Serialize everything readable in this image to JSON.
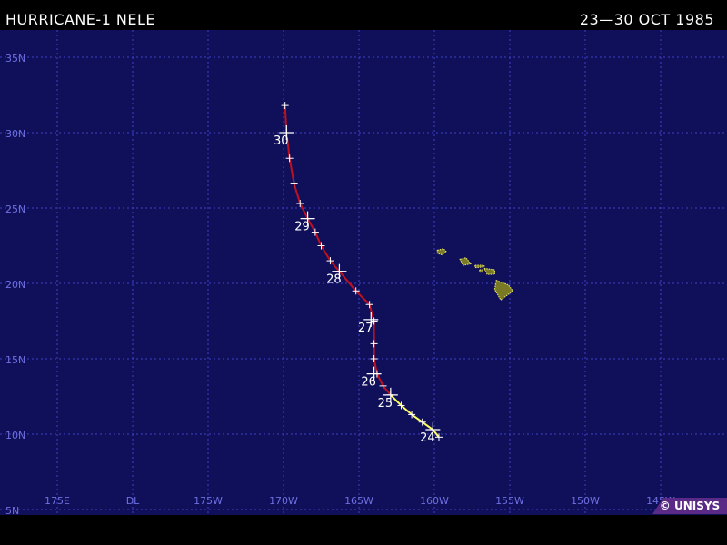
{
  "header": {
    "title": "HURRICANE-1 NELE",
    "date_range": "23—30 OCT 1985"
  },
  "map": {
    "lat_range": [
      5,
      36
    ],
    "lon_range": [
      -186,
      -144
    ],
    "lat_ticks": [
      {
        "lat": 35,
        "label": "35N"
      },
      {
        "lat": 30,
        "label": "30N"
      },
      {
        "lat": 25,
        "label": "25N"
      },
      {
        "lat": 20,
        "label": "20N"
      },
      {
        "lat": 15,
        "label": "15N"
      },
      {
        "lat": 10,
        "label": "10N"
      },
      {
        "lat": 5,
        "label": "5N"
      }
    ],
    "lon_ticks": [
      {
        "lon": -185,
        "label": "175E"
      },
      {
        "lon": -180,
        "label": "DL"
      },
      {
        "lon": -175,
        "label": "175W"
      },
      {
        "lon": -170,
        "label": "170W"
      },
      {
        "lon": -165,
        "label": "165W"
      },
      {
        "lon": -160,
        "label": "160W"
      },
      {
        "lon": -155,
        "label": "155W"
      },
      {
        "lon": -150,
        "label": "150W"
      },
      {
        "lon": -145,
        "label": "145W"
      }
    ],
    "colors": {
      "ocean": "#10105a",
      "grid": "#4040c8",
      "axis_label": "#6f6fe0",
      "land": "#7a7a26",
      "land_outline": "#e0e060",
      "tropical_storm": "#ffff60",
      "hurricane": "#c01020",
      "marker": "#ffffff"
    }
  },
  "track": {
    "storm_name": "NELE",
    "points": [
      {
        "lon": -159.7,
        "lat": 9.8,
        "stage": "storm"
      },
      {
        "lon": -160.1,
        "lat": 10.3,
        "stage": "storm"
      },
      {
        "lon": -160.8,
        "lat": 10.8,
        "stage": "storm"
      },
      {
        "lon": -161.5,
        "lat": 11.3,
        "stage": "storm"
      },
      {
        "lon": -162.2,
        "lat": 11.9,
        "stage": "storm"
      },
      {
        "lon": -162.9,
        "lat": 12.6,
        "stage": "storm"
      },
      {
        "lon": -163.4,
        "lat": 13.2,
        "stage": "hurricane"
      },
      {
        "lon": -163.8,
        "lat": 14.0,
        "stage": "hurricane"
      },
      {
        "lon": -164.0,
        "lat": 15.0,
        "stage": "hurricane"
      },
      {
        "lon": -164.0,
        "lat": 16.0,
        "stage": "hurricane"
      },
      {
        "lon": -164.0,
        "lat": 17.5,
        "stage": "hurricane"
      },
      {
        "lon": -164.3,
        "lat": 18.6,
        "stage": "hurricane"
      },
      {
        "lon": -165.2,
        "lat": 19.5,
        "stage": "hurricane"
      },
      {
        "lon": -166.3,
        "lat": 20.8,
        "stage": "hurricane"
      },
      {
        "lon": -166.9,
        "lat": 21.5,
        "stage": "hurricane"
      },
      {
        "lon": -167.5,
        "lat": 22.5,
        "stage": "hurricane"
      },
      {
        "lon": -167.9,
        "lat": 23.4,
        "stage": "hurricane"
      },
      {
        "lon": -168.4,
        "lat": 24.3,
        "stage": "hurricane"
      },
      {
        "lon": -168.9,
        "lat": 25.3,
        "stage": "hurricane"
      },
      {
        "lon": -169.3,
        "lat": 26.6,
        "stage": "hurricane"
      },
      {
        "lon": -169.6,
        "lat": 28.3,
        "stage": "hurricane"
      },
      {
        "lon": -169.8,
        "lat": 30.0,
        "stage": "hurricane"
      },
      {
        "lon": -169.9,
        "lat": 31.8,
        "stage": "hurricane"
      }
    ],
    "day_labels": [
      {
        "label": "24",
        "lon": -160.1,
        "lat": 10.3
      },
      {
        "label": "25",
        "lon": -162.9,
        "lat": 12.6
      },
      {
        "label": "26",
        "lon": -164.0,
        "lat": 14.0
      },
      {
        "label": "27",
        "lon": -164.2,
        "lat": 17.6
      },
      {
        "label": "28",
        "lon": -166.3,
        "lat": 20.8
      },
      {
        "label": "29",
        "lon": -168.4,
        "lat": 24.3
      },
      {
        "label": "30",
        "lon": -169.8,
        "lat": 30.0
      }
    ]
  },
  "islands": [
    {
      "name": "kauai",
      "coords": [
        [
          -159.8,
          22.2
        ],
        [
          -159.4,
          22.3
        ],
        [
          -159.2,
          22.1
        ],
        [
          -159.5,
          21.9
        ],
        [
          -159.8,
          22.0
        ]
      ]
    },
    {
      "name": "oahu",
      "coords": [
        [
          -158.3,
          21.6
        ],
        [
          -157.9,
          21.7
        ],
        [
          -157.6,
          21.3
        ],
        [
          -158.1,
          21.2
        ]
      ]
    },
    {
      "name": "molokai",
      "coords": [
        [
          -157.3,
          21.2
        ],
        [
          -156.7,
          21.2
        ],
        [
          -156.7,
          21.1
        ],
        [
          -157.3,
          21.05
        ]
      ]
    },
    {
      "name": "maui",
      "coords": [
        [
          -156.7,
          21.0
        ],
        [
          -156.0,
          20.9
        ],
        [
          -156.0,
          20.6
        ],
        [
          -156.5,
          20.6
        ]
      ]
    },
    {
      "name": "hawaii",
      "coords": [
        [
          -155.9,
          20.2
        ],
        [
          -155.1,
          19.9
        ],
        [
          -154.8,
          19.5
        ],
        [
          -155.6,
          18.9
        ],
        [
          -156.0,
          19.6
        ]
      ]
    },
    {
      "name": "lanai",
      "coords": [
        [
          -157.0,
          20.9
        ],
        [
          -156.8,
          20.9
        ],
        [
          -156.8,
          20.75
        ],
        [
          -157.0,
          20.75
        ]
      ]
    }
  ],
  "credit": "© UNISYS"
}
